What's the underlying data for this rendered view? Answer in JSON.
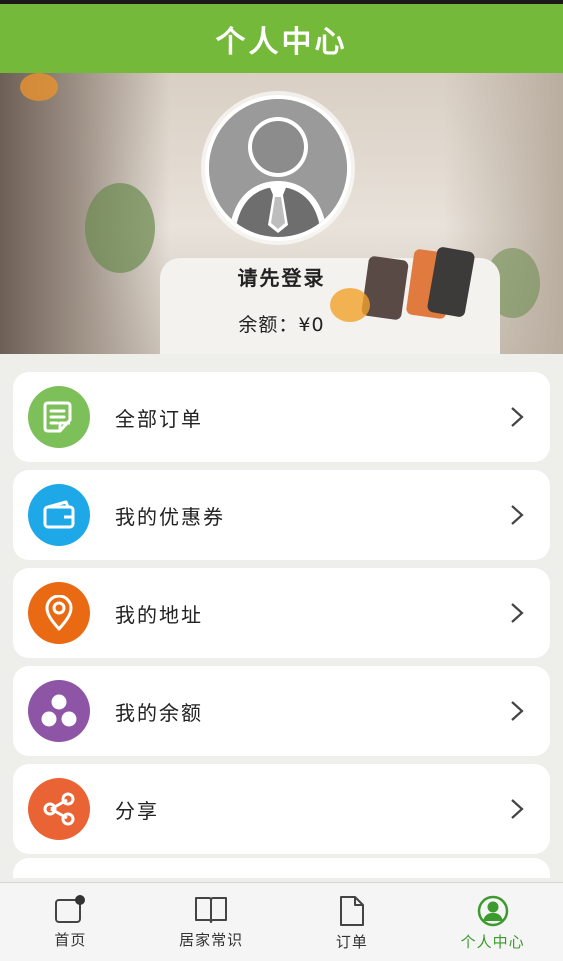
{
  "header": {
    "title": "个人中心"
  },
  "profile": {
    "login_prompt": "请先登录",
    "balance_label": "余额：",
    "balance_value": "¥0"
  },
  "menu": {
    "items": [
      {
        "label": "全部订单",
        "icon": "order-document-icon",
        "color": "#7dc05a"
      },
      {
        "label": "我的优惠券",
        "icon": "wallet-icon",
        "color": "#1ea8e8"
      },
      {
        "label": "我的地址",
        "icon": "location-pin-icon",
        "color": "#ea6a14"
      },
      {
        "label": "我的余额",
        "icon": "balance-dots-icon",
        "color": "#8e55a6"
      },
      {
        "label": "分享",
        "icon": "share-icon",
        "color": "#ea6334"
      }
    ]
  },
  "bottom_nav": {
    "items": [
      {
        "label": "首页",
        "icon": "home-icon",
        "active": false
      },
      {
        "label": "居家常识",
        "icon": "book-icon",
        "active": false
      },
      {
        "label": "订单",
        "icon": "document-icon",
        "active": false
      },
      {
        "label": "个人中心",
        "icon": "user-icon",
        "active": true
      }
    ]
  },
  "colors": {
    "accent": "#74b93a",
    "active_nav": "#3d9a2e",
    "background": "#eeefea"
  }
}
